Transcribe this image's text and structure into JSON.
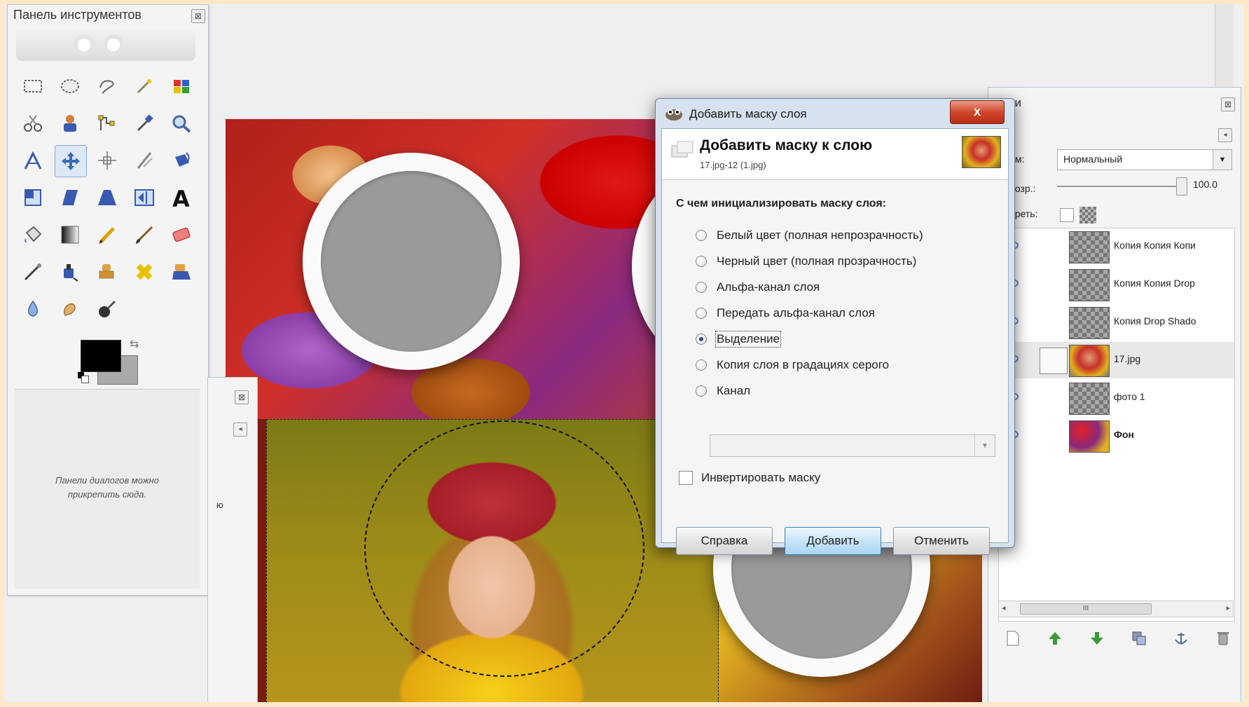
{
  "toolbox": {
    "title": "Панель инструментов",
    "close_icon": "close-icon",
    "tools": [
      "rect-select-icon",
      "ellipse-select-icon",
      "free-select-icon",
      "fuzzy-select-icon",
      "color-select-icon",
      "scissors-select-icon",
      "foreground-select-icon",
      "paths-icon",
      "color-picker-icon",
      "zoom-icon",
      "measure-icon",
      "move-icon",
      "align-icon",
      "crop-icon",
      "rotate-icon",
      "scale-icon",
      "shear-icon",
      "perspective-icon",
      "flip-icon",
      "text-icon",
      "bucket-fill-icon",
      "blend-icon",
      "pencil-icon",
      "paintbrush-icon",
      "eraser-icon",
      "airbrush-icon",
      "ink-icon",
      "clone-icon",
      "heal-icon",
      "perspective-clone-icon",
      "blur-icon",
      "smudge-icon",
      "dodge-burn-icon"
    ],
    "active_tool_index": 11,
    "foreground_color": "#000000",
    "background_color": "#aaaaaa",
    "dock_hint_line1": "Панели диалогов можно",
    "dock_hint_line2": "прикрепить сюда."
  },
  "left_panel": {
    "partial_text": "ю"
  },
  "layers_panel": {
    "title": "ои",
    "mode_label": "им:",
    "mode_value": "Нормальный",
    "opacity_label": "розр.:",
    "opacity_value": "100.0",
    "lock_label": "ереть:",
    "layers": [
      {
        "name": "Копия Копия Копи",
        "thumb": "transparent",
        "selected": false,
        "bold": false
      },
      {
        "name": "Копия Копия Drop",
        "thumb": "transparent",
        "selected": false,
        "bold": false
      },
      {
        "name": "Копия Drop Shado",
        "thumb": "transparent",
        "selected": false,
        "bold": false
      },
      {
        "name": "17.jpg",
        "thumb": "girl",
        "selected": true,
        "bold": false
      },
      {
        "name": "фото 1",
        "thumb": "transparent",
        "selected": false,
        "bold": false
      },
      {
        "name": "Фон",
        "thumb": "leaves",
        "selected": false,
        "bold": true
      }
    ],
    "scroll_thumb_label": "III"
  },
  "dialog": {
    "window_title": "Добавить маску слоя",
    "close_label": "x",
    "header_title": "Добавить маску к слою",
    "header_subtitle": "17.jpg-12 (1.jpg)",
    "question": "С чем инициализировать маску слоя:",
    "options": [
      {
        "label": "Белый цвет (полная непрозрачность)",
        "checked": false
      },
      {
        "label": "Черный цвет (полная прозрачность)",
        "checked": false
      },
      {
        "label": "Альфа-канал слоя",
        "checked": false
      },
      {
        "label": "Передать альфа-канал слоя",
        "checked": false
      },
      {
        "label": "Выделение",
        "checked": true
      },
      {
        "label": "Копия слоя в градациях серого",
        "checked": false
      },
      {
        "label": "Канал",
        "checked": false
      }
    ],
    "invert_label": "Инвертировать маску",
    "invert_checked": false,
    "buttons": {
      "help": "Справка",
      "add": "Добавить",
      "cancel": "Отменить"
    }
  }
}
